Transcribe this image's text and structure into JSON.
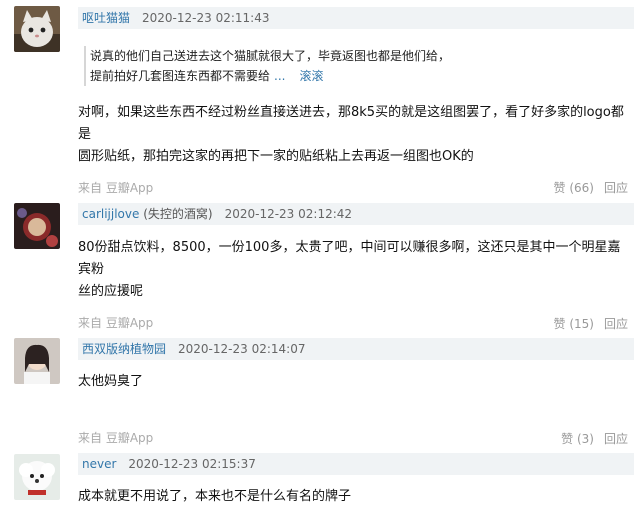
{
  "comments": [
    {
      "author": "呕吐猫猫",
      "author_suffix": "",
      "time": "2020-12-23 02:11:43",
      "quote": {
        "line1": "说真的他们自己送进去这个猫腻就很大了，毕竟返图也都是他们给，",
        "line2": "提前拍好几套图连东西都不需要给",
        "more": "...",
        "author": "滚滚"
      },
      "content": [
        "对啊，如果这些东西不经过粉丝直接送进去，那8k5买的就是这组图罢了，看了好多家的logo都是",
        "圆形贴纸，那拍完这家的再把下一家的贴纸粘上去再返一组图也OK的"
      ],
      "source": "来自 豆瓣App",
      "likes": "赞 (66)",
      "reply": "回应"
    },
    {
      "author": "carlijjlove",
      "author_suffix": " (失控的酒窝)",
      "time": "2020-12-23 02:12:42",
      "content": [
        "80份甜点饮料，8500，一份100多，太贵了吧，中间可以赚很多啊，这还只是其中一个明星嘉宾粉",
        "丝的应援呢"
      ],
      "source": "来自 豆瓣App",
      "likes": "赞 (15)",
      "reply": "回应"
    },
    {
      "author": "西双版纳植物园",
      "author_suffix": "",
      "time": "2020-12-23 02:14:07",
      "content": [
        "太他妈臭了"
      ],
      "source": "来自 豆瓣App",
      "likes": "赞 (3)",
      "reply": "回应"
    },
    {
      "author": "never",
      "author_suffix": "",
      "time": "2020-12-23 02:15:37",
      "content": [
        "成本就更不用说了，本来也不是什么有名的牌子"
      ]
    }
  ],
  "colors": {
    "link": "#3377aa",
    "meta_bg": "#f0f3f5",
    "muted": "#aaaaaa"
  }
}
